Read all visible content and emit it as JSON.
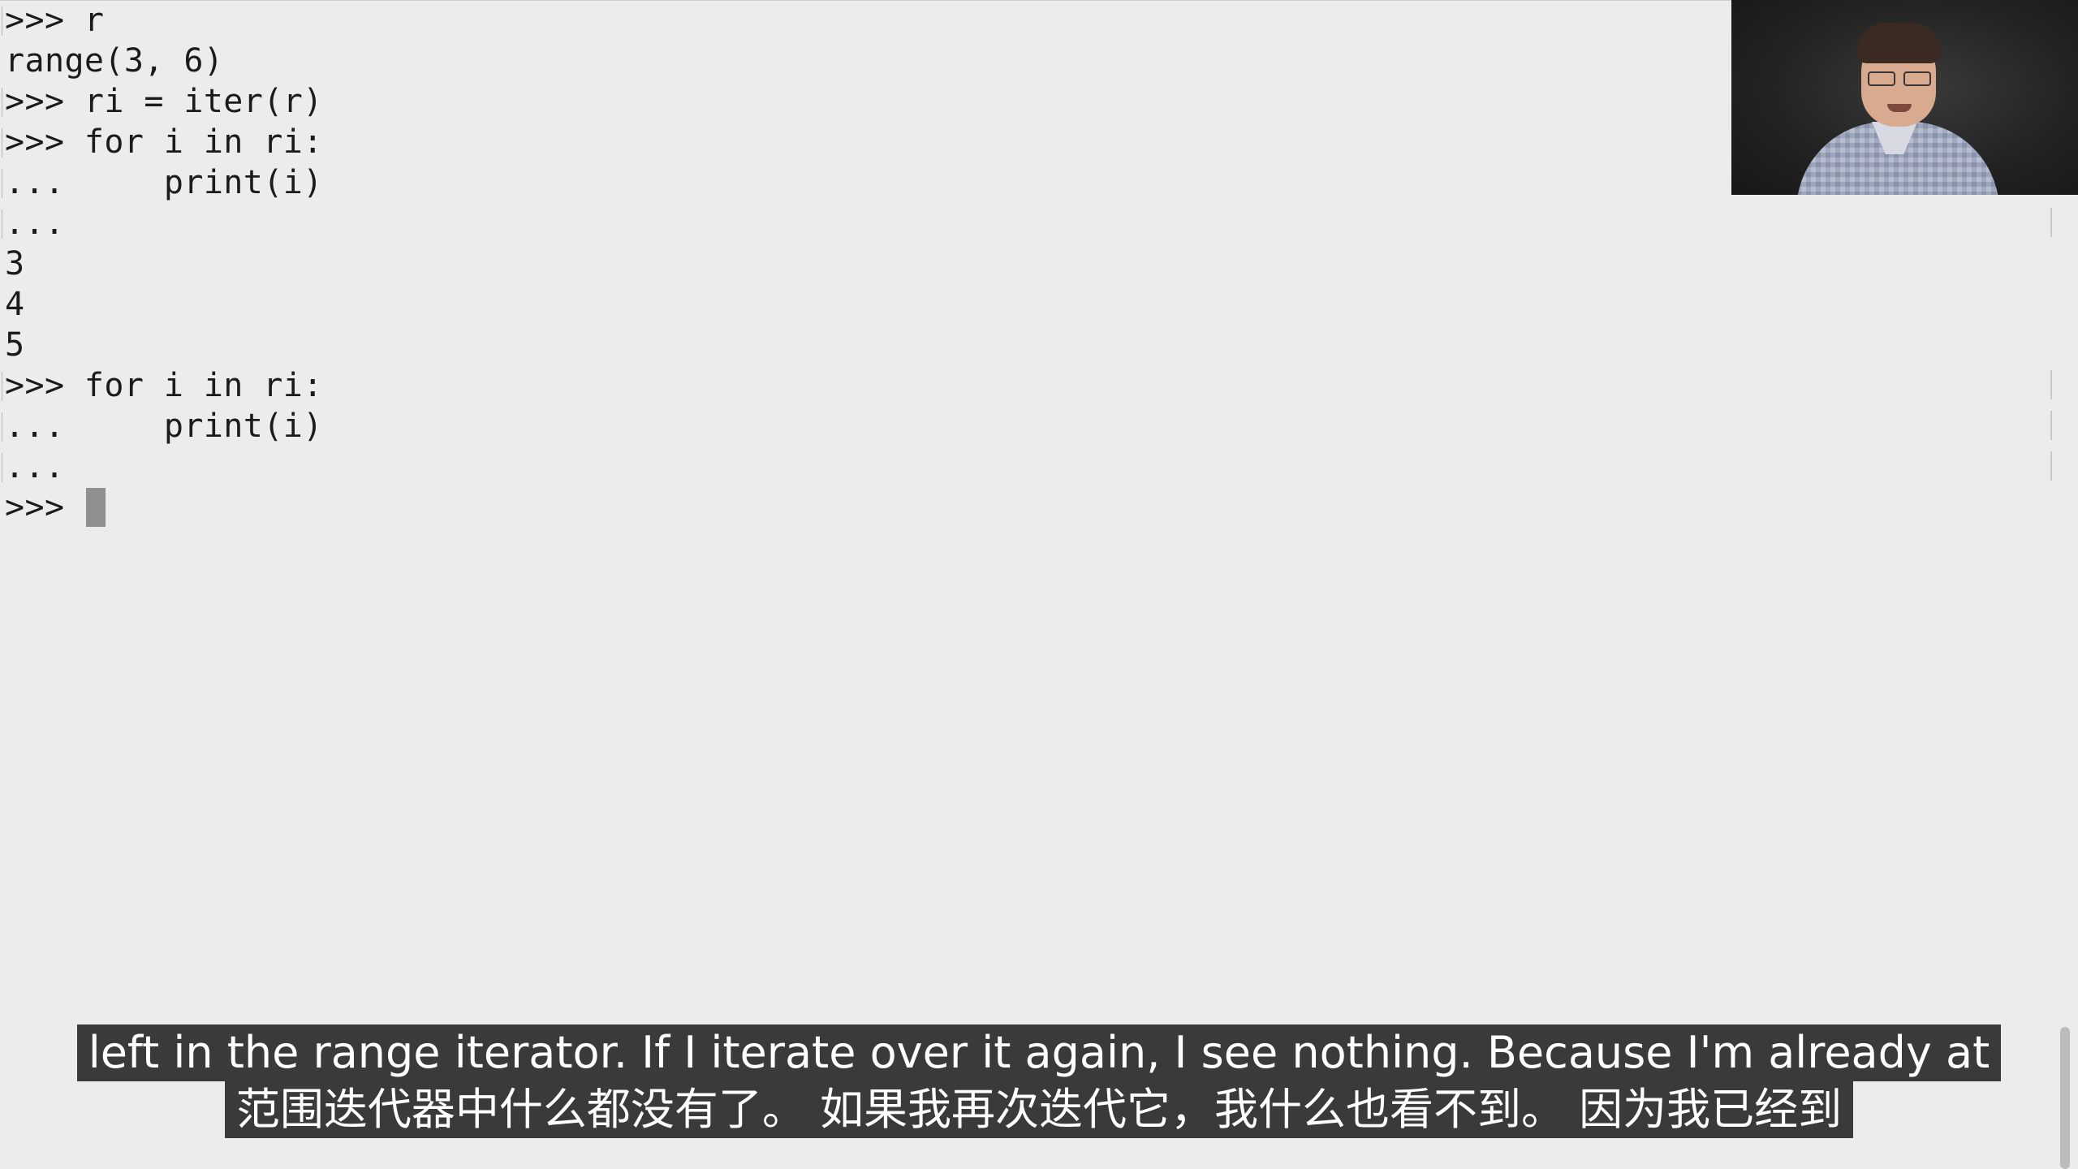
{
  "terminal": {
    "lines": [
      {
        "text": ">>> r",
        "bracket": true
      },
      {
        "text": "range(3, 6)",
        "bracket": false
      },
      {
        "text": ">>> ri = iter(r)",
        "bracket": true
      },
      {
        "text": ">>> for i in ri:",
        "bracket": true
      },
      {
        "text": "...     print(i)",
        "bracket": true
      },
      {
        "text": "...",
        "bracket": true
      },
      {
        "text": "3",
        "bracket": false
      },
      {
        "text": "4",
        "bracket": false
      },
      {
        "text": "5",
        "bracket": false
      },
      {
        "text": ">>> for i in ri:",
        "bracket": true
      },
      {
        "text": "...     print(i)",
        "bracket": true
      },
      {
        "text": "...",
        "bracket": true
      },
      {
        "text": ">>> ",
        "bracket": false
      }
    ]
  },
  "subtitles": {
    "english": "left in the range iterator. If I iterate over it again, I see nothing. Because I'm already at",
    "chinese": "范围迭代器中什么都没有了。 如果我再次迭代它，我什么也看不到。 因为我已经到"
  }
}
